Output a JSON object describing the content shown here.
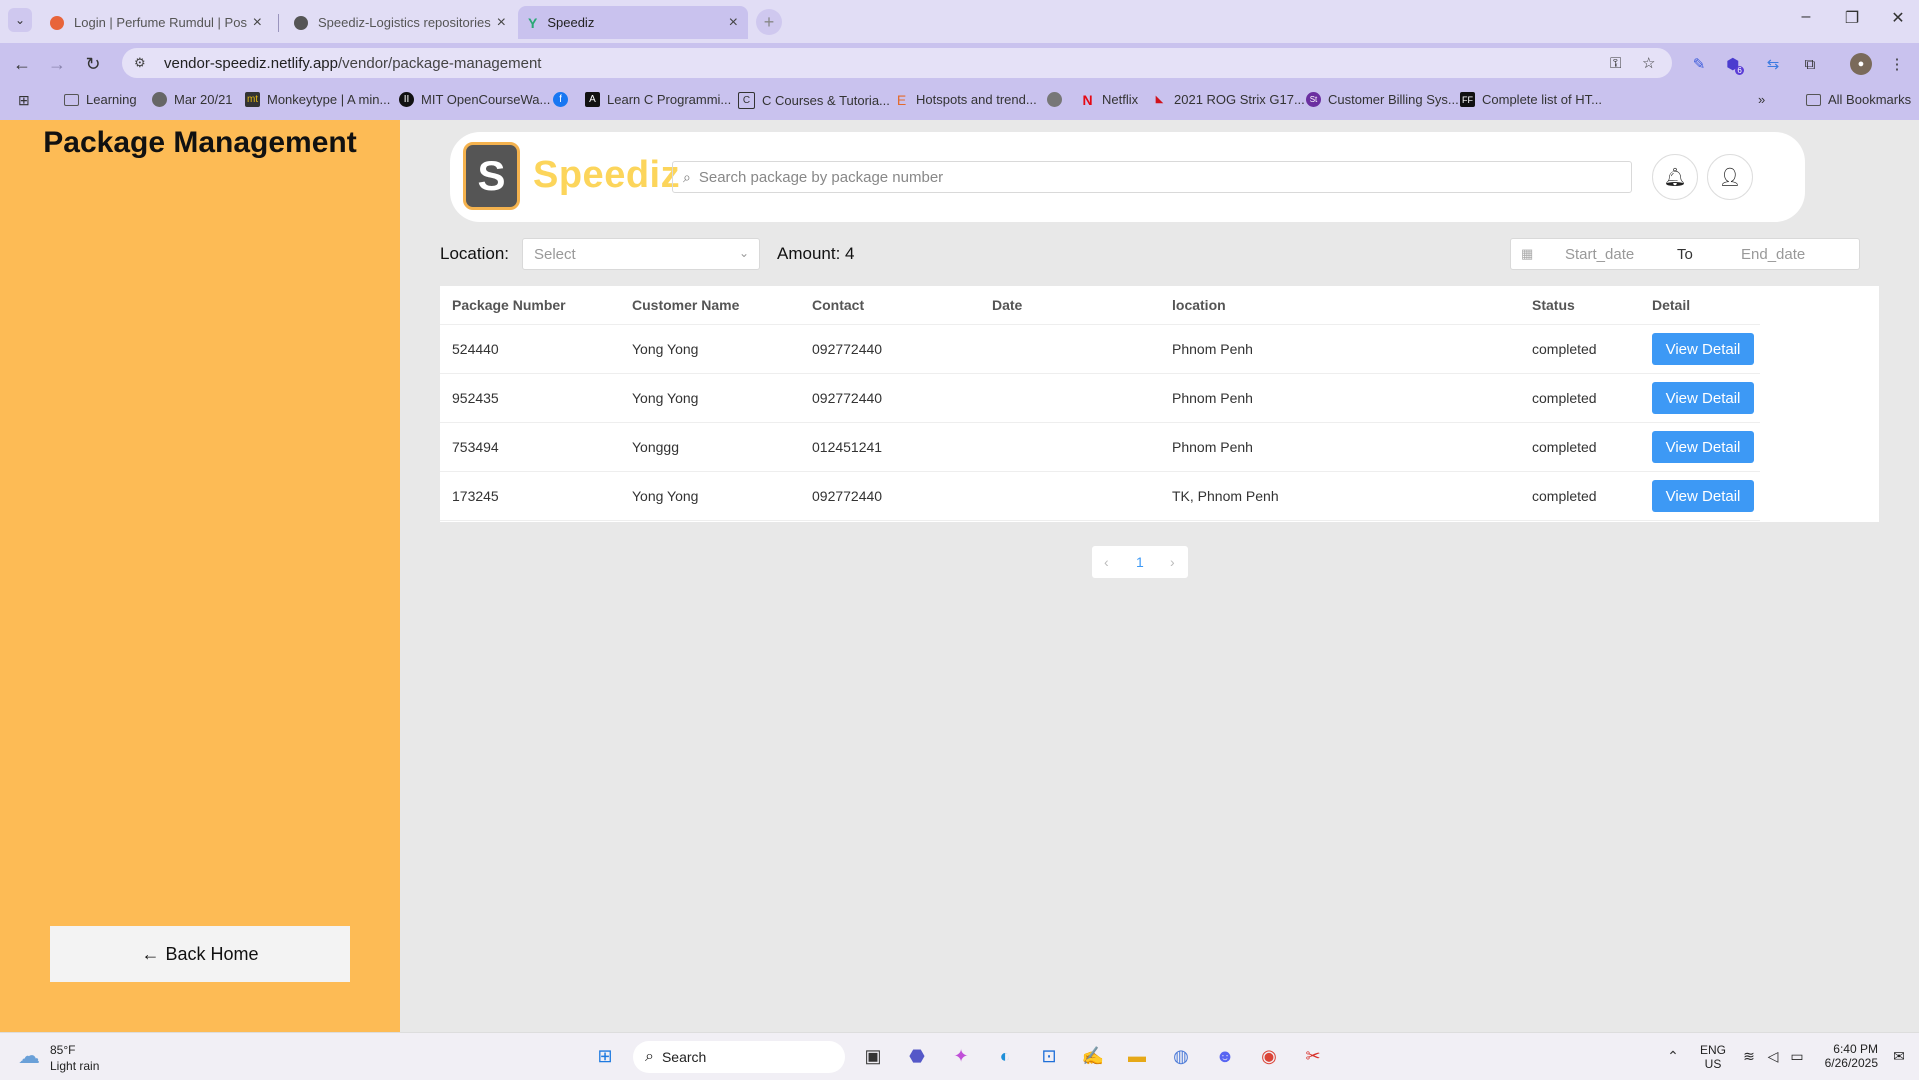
{
  "browser": {
    "tabs": [
      {
        "title": "Login | Perfume Rumdul | Postm",
        "favicon_color": "#e8643a",
        "active": false
      },
      {
        "title": "Speediz-Logistics repositories",
        "favicon_color": "#555555",
        "active": false
      },
      {
        "title": "Speediz",
        "favicon_color": "#2aa876",
        "active": true
      }
    ],
    "address": {
      "host": "vendor-speediz.netlify.app",
      "path": "/vendor/package-management"
    },
    "bookmarks": [
      {
        "label": "Learning",
        "icon": "folder-icon"
      },
      {
        "label": "Mar 20/21",
        "icon": "globe-icon"
      },
      {
        "label": "Monkeytype | A min...",
        "icon": "monkeytype-icon"
      },
      {
        "label": "MIT OpenCourseWa...",
        "icon": "mit-icon"
      },
      {
        "label": "",
        "icon": "facebook-icon"
      },
      {
        "label": "Learn C Programmi...",
        "icon": "learnc-icon"
      },
      {
        "label": "C Courses & Tutoria...",
        "icon": "c-icon"
      },
      {
        "label": "Hotspots and trend...",
        "icon": "e-icon"
      },
      {
        "label": "",
        "icon": "globe-icon"
      },
      {
        "label": "Netflix",
        "icon": "netflix-icon"
      },
      {
        "label": "2021 ROG Strix G17...",
        "icon": "rog-icon"
      },
      {
        "label": "Customer Billing Sys...",
        "icon": "st-icon"
      },
      {
        "label": "Complete list of HT...",
        "icon": "ff-icon"
      }
    ],
    "all_bookmarks": "All Bookmarks"
  },
  "sidebar": {
    "title": "Package Management",
    "back_home": "Back Home"
  },
  "header": {
    "logo_letter": "S",
    "brand": "Speediz",
    "search_placeholder": "Search package by package number"
  },
  "filters": {
    "location_label": "Location:",
    "location_placeholder": "Select",
    "amount_label": "Amount: 4",
    "start_placeholder": "Start_date",
    "to_label": "To",
    "end_placeholder": "End_date"
  },
  "table": {
    "columns": [
      "Package Number",
      "Customer Name",
      "Contact",
      "Date",
      "location",
      "Status",
      "Detail"
    ],
    "rows": [
      {
        "package": "524440",
        "customer": "Yong Yong",
        "contact": "092772440",
        "date": "",
        "location": "Phnom Penh",
        "status": "completed",
        "action": "View Detail"
      },
      {
        "package": "952435",
        "customer": "Yong Yong",
        "contact": "092772440",
        "date": "",
        "location": "Phnom Penh",
        "status": "completed",
        "action": "View Detail"
      },
      {
        "package": "753494",
        "customer": "Yonggg",
        "contact": "012451241",
        "date": "",
        "location": "Phnom Penh",
        "status": "completed",
        "action": "View Detail"
      },
      {
        "package": "173245",
        "customer": "Yong Yong",
        "contact": "092772440",
        "date": "",
        "location": "TK, Phnom Penh",
        "status": "completed",
        "action": "View Detail"
      }
    ]
  },
  "pagination": {
    "current": "1"
  },
  "taskbar": {
    "weather_temp": "85°F",
    "weather_desc": "Light rain",
    "search_label": "Search",
    "lang_1": "ENG",
    "lang_2": "US",
    "time": "6:40 PM",
    "date": "6/26/2025",
    "badge": "6"
  },
  "colors": {
    "sidebar": "#fdbb55",
    "brand": "#fcd55b",
    "primary_button": "#3d99f5",
    "browser_chrome": "#c9c2ee"
  }
}
